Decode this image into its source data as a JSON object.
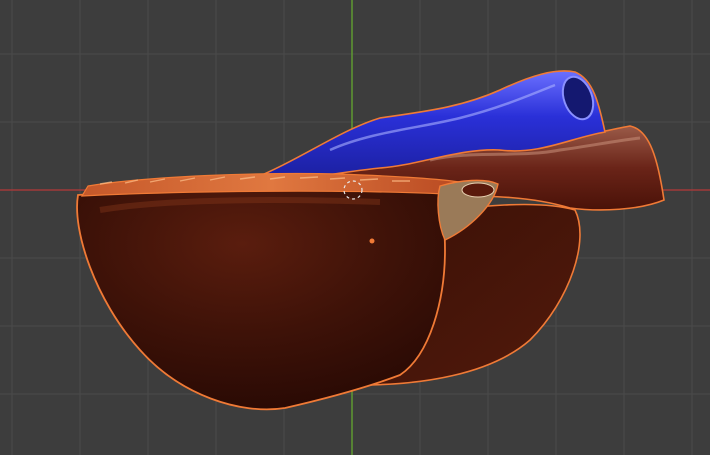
{
  "viewport": {
    "view": "orthographic-side",
    "background_color": "#3d3d3d",
    "grid_color": "#4a4a4a",
    "x_axis_color": "#a23a3a",
    "z_axis_color": "#5e9a32"
  },
  "object": {
    "selection_outline_color": "#f07a36",
    "selected": true,
    "parts": [
      "liver-body",
      "hepatic-vein",
      "portal-vessel",
      "gallbladder",
      "cut-surface"
    ],
    "colors": {
      "liver": "#4a170b",
      "liver_highlight": "#7a3218",
      "vein": "#2a2fd0",
      "vein_highlight": "#8a90ff",
      "portal": "#6a2418",
      "gallbladder": "#c9a27a"
    }
  },
  "gizmos": {
    "origin_dot_color": "#f07a36",
    "cursor_color": "#e8e8e8"
  }
}
